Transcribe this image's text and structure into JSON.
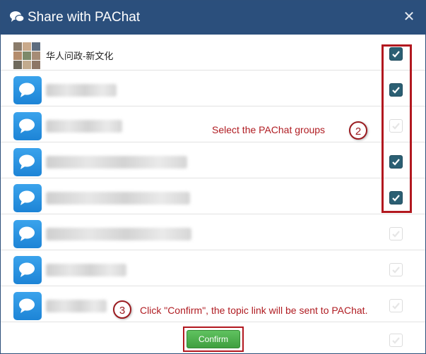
{
  "dialog": {
    "title": "Share with PAChat",
    "title_icon": "chat-bubbles-icon",
    "close_icon": "close-icon"
  },
  "groups": [
    {
      "name": "华人问政-新文化",
      "checked": true
    },
    {
      "name": "",
      "checked": true
    },
    {
      "name": "",
      "checked": false
    },
    {
      "name": "",
      "checked": true
    },
    {
      "name": "",
      "checked": true
    },
    {
      "name": "",
      "checked": false
    },
    {
      "name": "",
      "checked": false
    },
    {
      "name": "",
      "checked": false
    },
    {
      "name": "",
      "checked": false
    }
  ],
  "annotations": {
    "step2_number": "2",
    "step2_text": "Select the PAChat groups",
    "step3_number": "3",
    "step3_text": "Click \"Confirm\", the topic link will be sent to PAChat."
  },
  "confirm_label": "Confirm",
  "colors": {
    "title_bar": "#2b4f7c",
    "checkbox_checked": "#2b5f73",
    "annotation_red": "#b01c22",
    "confirm_green": "#4cae4c",
    "avatar_blue": "#2a93e3"
  }
}
